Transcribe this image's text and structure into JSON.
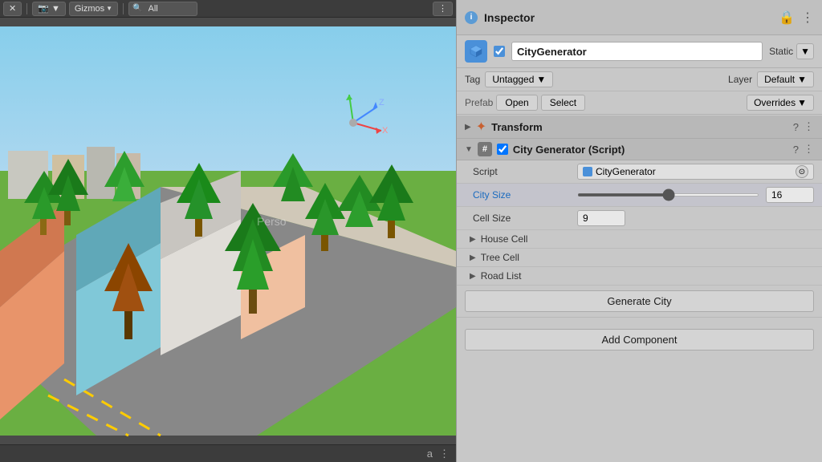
{
  "scene": {
    "toolbar": {
      "transform_tools": "✕",
      "camera_label": "📷▼",
      "gizmos_label": "Gizmos",
      "gizmos_arrow": "▼",
      "search_placeholder": "🔍 All",
      "search_value": "All",
      "bottom_lock": "a",
      "bottom_menu": "⋮"
    }
  },
  "inspector": {
    "title": "Inspector",
    "info_icon": "i",
    "lock_icon": "🔒",
    "menu_icon": "⋮",
    "gameobject": {
      "name": "CityGenerator",
      "checkbox_checked": true,
      "static_label": "Static",
      "static_arrow": "▼"
    },
    "tag_label": "Tag",
    "tag_value": "Untagged",
    "tag_arrow": "▼",
    "layer_label": "Layer",
    "layer_value": "Default",
    "layer_arrow": "▼",
    "prefab": {
      "label": "Prefab",
      "open_label": "Open",
      "select_label": "Select",
      "overrides_label": "Overrides",
      "overrides_arrow": "▼"
    },
    "transform": {
      "name": "Transform",
      "arrow": "▶",
      "icon": "🔧",
      "help_icon": "?",
      "settings_icon": "⋮"
    },
    "city_generator_script": {
      "arrow": "▼",
      "hash_icon": "#",
      "checkbox_checked": true,
      "name": "City Generator (Script)",
      "help_icon": "?",
      "settings_icon": "⋮",
      "fields": {
        "script_label": "Script",
        "script_value": "CityGenerator",
        "city_size_label": "City Size",
        "city_size_value": "16",
        "city_size_slider_min": 0,
        "city_size_slider_max": 32,
        "city_size_slider_val": 16,
        "cell_size_label": "Cell Size",
        "cell_size_value": "9",
        "house_cell_label": "House Cell",
        "tree_cell_label": "Tree Cell",
        "road_list_label": "Road List"
      }
    },
    "generate_city_btn": "Generate City",
    "add_component_btn": "Add Component"
  }
}
